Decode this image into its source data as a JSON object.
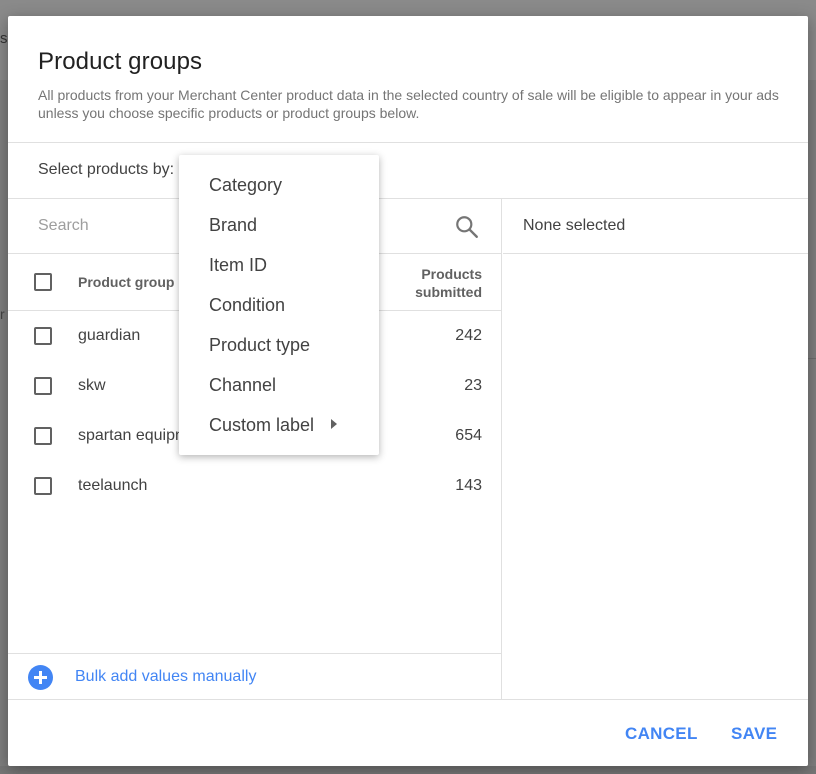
{
  "background": {
    "letter_top": "s",
    "letter_mid": "r"
  },
  "dialog": {
    "title": "Product groups",
    "description": "All products from your Merchant Center product data in the selected country of sale will be eligible to appear in your ads unless you choose specific products or product groups below.",
    "select_label": "Select products by:",
    "search": {
      "placeholder": "Search",
      "value": ""
    },
    "table": {
      "header_group": "Product group",
      "header_count": "Products submitted",
      "rows": [
        {
          "name": "guardian",
          "count": "242",
          "checked": false
        },
        {
          "name": "skw",
          "count": "23",
          "checked": false
        },
        {
          "name": "spartan equipment",
          "count": "654",
          "checked": false
        },
        {
          "name": "teelaunch",
          "count": "143",
          "checked": false
        }
      ]
    },
    "bulk_add_label": "Bulk add values manually",
    "selected_panel": {
      "empty_text": "None selected"
    },
    "buttons": {
      "cancel": "CANCEL",
      "save": "SAVE"
    }
  },
  "dropdown_menu": {
    "items": [
      {
        "label": "Category"
      },
      {
        "label": "Brand"
      },
      {
        "label": "Item ID"
      },
      {
        "label": "Condition"
      },
      {
        "label": "Product type"
      },
      {
        "label": "Channel"
      },
      {
        "label": "Custom label",
        "has_submenu": true
      }
    ]
  },
  "colors": {
    "accent": "#4285f4",
    "scrim": "#7f7f7f",
    "text_primary": "#212121",
    "text_secondary": "#757575",
    "divider": "#e0e0e0"
  }
}
